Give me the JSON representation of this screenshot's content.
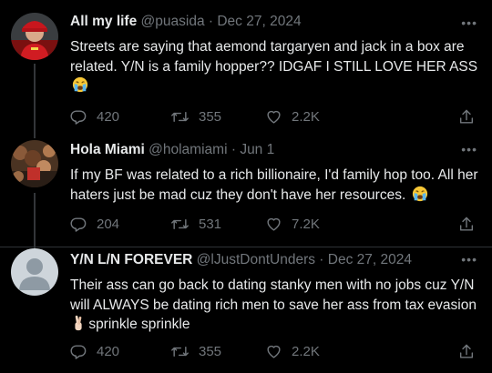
{
  "tweets": [
    {
      "name": "All my life",
      "handle": "@puasida",
      "dot": "·",
      "date": "Dec 27, 2024",
      "text": "Streets are saying that aemond targaryen and jack in a box are related. Y/N is a family hopper?? IDGAF I STILL LOVE HER ASS",
      "emoji": "crying-face",
      "replies": "420",
      "retweets": "355",
      "likes": "2.2K"
    },
    {
      "name": "Hola Miami",
      "handle": "@holamiami",
      "dot": "·",
      "date": "Jun 1",
      "text": "If my BF was related to a rich billionaire, I'd family hop too. All her haters just be mad cuz they don't have her resources.",
      "emoji": "crying-face",
      "replies": "204",
      "retweets": "531",
      "likes": "7.2K"
    },
    {
      "name": "Y/N L/N FOREVER",
      "handle": "@lJustDontUnders",
      "dot": "·",
      "date": "Dec 27, 2024",
      "text_before": "Their ass can go back to dating stanky men with no jobs cuz Y/N will ALWAYS be dating rich men to save her ass from tax evasion",
      "text_after": "sprinkle sprinkle",
      "emoji": "crossed-fingers",
      "replies": "420",
      "retweets": "355",
      "likes": "2.2K"
    }
  ],
  "ui": {
    "more_glyph": "•••",
    "icons": [
      "reply-icon",
      "retweet-icon",
      "like-icon",
      "share-icon",
      "more-icon"
    ]
  },
  "colors": {
    "background": "#000000",
    "text": "#e7e9ea",
    "secondary": "#71767b",
    "divider": "#2f3336"
  }
}
